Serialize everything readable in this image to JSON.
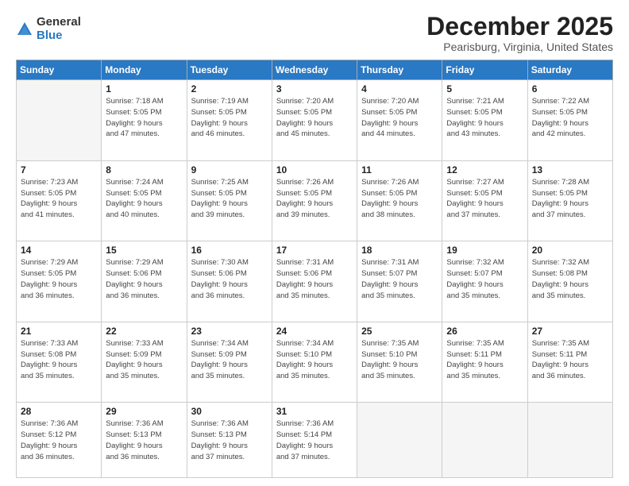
{
  "logo": {
    "general": "General",
    "blue": "Blue"
  },
  "title": "December 2025",
  "location": "Pearisburg, Virginia, United States",
  "days_of_week": [
    "Sunday",
    "Monday",
    "Tuesday",
    "Wednesday",
    "Thursday",
    "Friday",
    "Saturday"
  ],
  "weeks": [
    [
      {
        "num": "",
        "info": ""
      },
      {
        "num": "1",
        "info": "Sunrise: 7:18 AM\nSunset: 5:05 PM\nDaylight: 9 hours\nand 47 minutes."
      },
      {
        "num": "2",
        "info": "Sunrise: 7:19 AM\nSunset: 5:05 PM\nDaylight: 9 hours\nand 46 minutes."
      },
      {
        "num": "3",
        "info": "Sunrise: 7:20 AM\nSunset: 5:05 PM\nDaylight: 9 hours\nand 45 minutes."
      },
      {
        "num": "4",
        "info": "Sunrise: 7:20 AM\nSunset: 5:05 PM\nDaylight: 9 hours\nand 44 minutes."
      },
      {
        "num": "5",
        "info": "Sunrise: 7:21 AM\nSunset: 5:05 PM\nDaylight: 9 hours\nand 43 minutes."
      },
      {
        "num": "6",
        "info": "Sunrise: 7:22 AM\nSunset: 5:05 PM\nDaylight: 9 hours\nand 42 minutes."
      }
    ],
    [
      {
        "num": "7",
        "info": "Sunrise: 7:23 AM\nSunset: 5:05 PM\nDaylight: 9 hours\nand 41 minutes."
      },
      {
        "num": "8",
        "info": "Sunrise: 7:24 AM\nSunset: 5:05 PM\nDaylight: 9 hours\nand 40 minutes."
      },
      {
        "num": "9",
        "info": "Sunrise: 7:25 AM\nSunset: 5:05 PM\nDaylight: 9 hours\nand 39 minutes."
      },
      {
        "num": "10",
        "info": "Sunrise: 7:26 AM\nSunset: 5:05 PM\nDaylight: 9 hours\nand 39 minutes."
      },
      {
        "num": "11",
        "info": "Sunrise: 7:26 AM\nSunset: 5:05 PM\nDaylight: 9 hours\nand 38 minutes."
      },
      {
        "num": "12",
        "info": "Sunrise: 7:27 AM\nSunset: 5:05 PM\nDaylight: 9 hours\nand 37 minutes."
      },
      {
        "num": "13",
        "info": "Sunrise: 7:28 AM\nSunset: 5:05 PM\nDaylight: 9 hours\nand 37 minutes."
      }
    ],
    [
      {
        "num": "14",
        "info": "Sunrise: 7:29 AM\nSunset: 5:05 PM\nDaylight: 9 hours\nand 36 minutes."
      },
      {
        "num": "15",
        "info": "Sunrise: 7:29 AM\nSunset: 5:06 PM\nDaylight: 9 hours\nand 36 minutes."
      },
      {
        "num": "16",
        "info": "Sunrise: 7:30 AM\nSunset: 5:06 PM\nDaylight: 9 hours\nand 36 minutes."
      },
      {
        "num": "17",
        "info": "Sunrise: 7:31 AM\nSunset: 5:06 PM\nDaylight: 9 hours\nand 35 minutes."
      },
      {
        "num": "18",
        "info": "Sunrise: 7:31 AM\nSunset: 5:07 PM\nDaylight: 9 hours\nand 35 minutes."
      },
      {
        "num": "19",
        "info": "Sunrise: 7:32 AM\nSunset: 5:07 PM\nDaylight: 9 hours\nand 35 minutes."
      },
      {
        "num": "20",
        "info": "Sunrise: 7:32 AM\nSunset: 5:08 PM\nDaylight: 9 hours\nand 35 minutes."
      }
    ],
    [
      {
        "num": "21",
        "info": "Sunrise: 7:33 AM\nSunset: 5:08 PM\nDaylight: 9 hours\nand 35 minutes."
      },
      {
        "num": "22",
        "info": "Sunrise: 7:33 AM\nSunset: 5:09 PM\nDaylight: 9 hours\nand 35 minutes."
      },
      {
        "num": "23",
        "info": "Sunrise: 7:34 AM\nSunset: 5:09 PM\nDaylight: 9 hours\nand 35 minutes."
      },
      {
        "num": "24",
        "info": "Sunrise: 7:34 AM\nSunset: 5:10 PM\nDaylight: 9 hours\nand 35 minutes."
      },
      {
        "num": "25",
        "info": "Sunrise: 7:35 AM\nSunset: 5:10 PM\nDaylight: 9 hours\nand 35 minutes."
      },
      {
        "num": "26",
        "info": "Sunrise: 7:35 AM\nSunset: 5:11 PM\nDaylight: 9 hours\nand 35 minutes."
      },
      {
        "num": "27",
        "info": "Sunrise: 7:35 AM\nSunset: 5:11 PM\nDaylight: 9 hours\nand 36 minutes."
      }
    ],
    [
      {
        "num": "28",
        "info": "Sunrise: 7:36 AM\nSunset: 5:12 PM\nDaylight: 9 hours\nand 36 minutes."
      },
      {
        "num": "29",
        "info": "Sunrise: 7:36 AM\nSunset: 5:13 PM\nDaylight: 9 hours\nand 36 minutes."
      },
      {
        "num": "30",
        "info": "Sunrise: 7:36 AM\nSunset: 5:13 PM\nDaylight: 9 hours\nand 37 minutes."
      },
      {
        "num": "31",
        "info": "Sunrise: 7:36 AM\nSunset: 5:14 PM\nDaylight: 9 hours\nand 37 minutes."
      },
      {
        "num": "",
        "info": ""
      },
      {
        "num": "",
        "info": ""
      },
      {
        "num": "",
        "info": ""
      }
    ]
  ]
}
